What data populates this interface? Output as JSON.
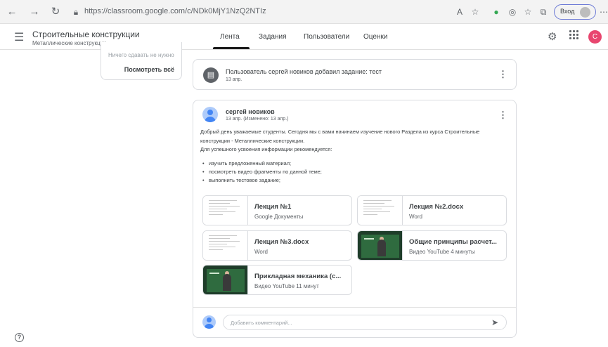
{
  "browser": {
    "url": "https://classroom.google.com/c/NDk0MjY1NzQ2NTIz",
    "profile_label": "Вход",
    "icons": [
      "back-icon",
      "forward-icon",
      "reload-icon",
      "lock-icon",
      "read-aloud-icon",
      "favorite-icon",
      "extension-icon",
      "tracking-icon",
      "favorites-bar-icon",
      "collections-icon",
      "more-icon"
    ]
  },
  "header": {
    "course_title": "Строительные конструкции",
    "course_subtitle": "Металлические конструкции",
    "tabs": [
      {
        "label": "Лента",
        "active": true
      },
      {
        "label": "Задания",
        "active": false
      },
      {
        "label": "Пользователи",
        "active": false
      },
      {
        "label": "Оценки",
        "active": false
      }
    ],
    "avatar_letter": "C"
  },
  "upcoming": {
    "empty_text": "Ничего сдавать не нужно",
    "view_all": "Посмотреть всё"
  },
  "assignment_notice": {
    "text": "Пользователь сергей новиков добавил задание: тест",
    "date": "13 апр."
  },
  "post": {
    "author": "сергей новиков",
    "date": "13 апр. (Изменено: 13 апр.)",
    "lines": [
      "Добрый день уважаемые студенты. Сегодня мы с вами начинаем изучение нового Раздела из курса Строительные",
      "конструкции - Металлические конструкции.",
      "Для успешного усвоения информации рекомендуется:"
    ],
    "bullets": [
      "изучить предложенный материал;",
      "посмотреть видео фрагменты по данной теме;",
      "выполнить тестовое задание;"
    ],
    "attachments": [
      {
        "title": "Лекция №1",
        "subtitle": "Google Документы",
        "kind": "doc"
      },
      {
        "title": "Лекция №2.docx",
        "subtitle": "Word",
        "kind": "doc"
      },
      {
        "title": "Лекция №3.docx",
        "subtitle": "Word",
        "kind": "doc"
      },
      {
        "title": "Общие принципы расчет...",
        "subtitle": "Видео YouTube   4 минуты",
        "kind": "video"
      },
      {
        "title": "Прикладная механика (с...",
        "subtitle": "Видео YouTube   11 минут",
        "kind": "video"
      }
    ],
    "comment_placeholder": "Добавить комментарий..."
  }
}
